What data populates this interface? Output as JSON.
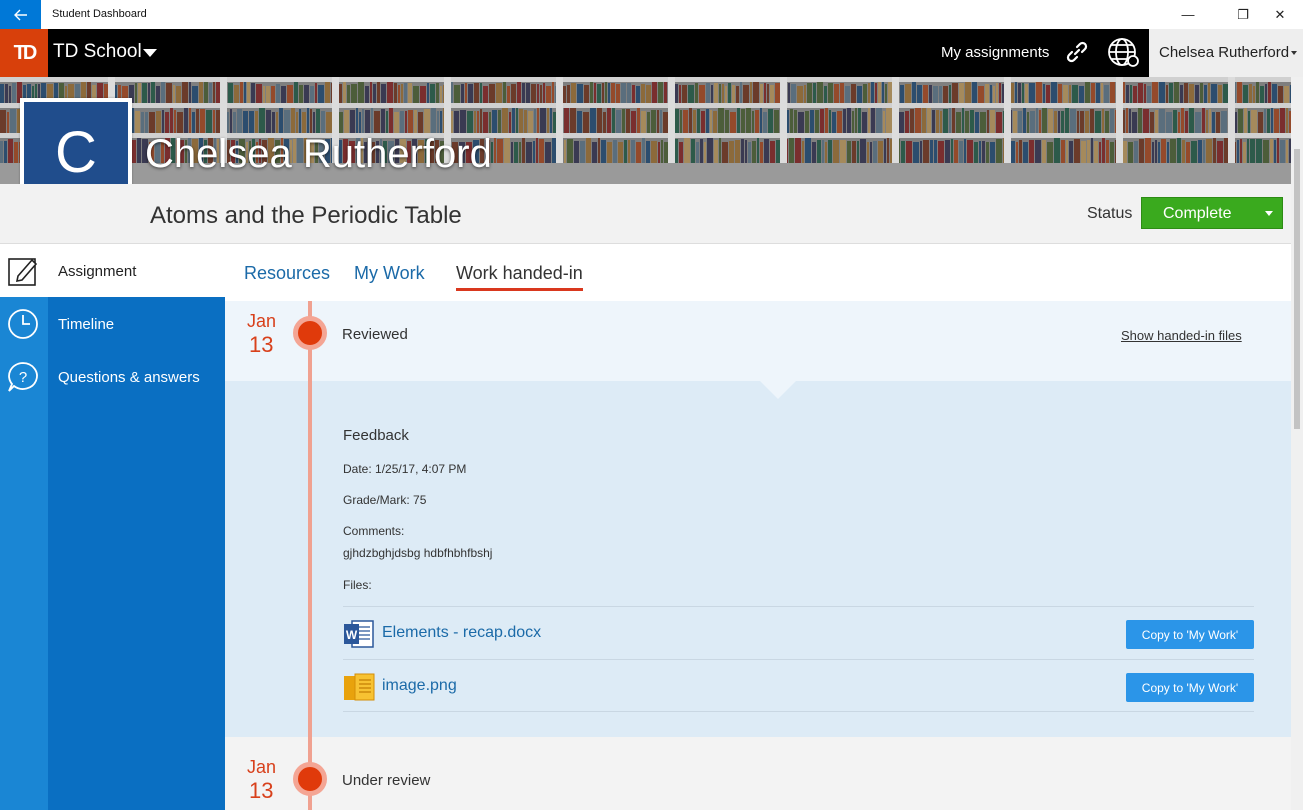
{
  "window": {
    "title": "Student Dashboard",
    "back_icon": "arrow-left-icon",
    "minimize": "—",
    "restore": "❐",
    "close": "✕"
  },
  "topnav": {
    "logo_text": "TD",
    "school": "TD School",
    "my_assignments": "My assignments",
    "user": "Chelsea Rutherford"
  },
  "profile": {
    "initial": "C",
    "name": "Chelsea Rutherford"
  },
  "assignment": {
    "title": "Atoms and the Periodic Table",
    "status_label": "Status",
    "status_value": "Complete",
    "status_color": "#3aaa1e"
  },
  "sidebar": {
    "items": [
      {
        "label": "Assignment",
        "icon": "pencil-icon"
      },
      {
        "label": "Timeline",
        "icon": "clock-icon"
      },
      {
        "label": "Questions & answers",
        "icon": "question-icon"
      }
    ]
  },
  "tabs": [
    {
      "label": "Resources"
    },
    {
      "label": "My Work"
    },
    {
      "label": "Work handed-in"
    }
  ],
  "timeline": {
    "events": [
      {
        "month": "Jan",
        "day": "13",
        "label": "Reviewed",
        "action": "Show handed-in files"
      },
      {
        "month": "Jan",
        "day": "13",
        "label": "Under review"
      }
    ],
    "feedback": {
      "title": "Feedback",
      "date_label": "Date:",
      "date_value": "1/25/17, 4:07 PM",
      "grade_label": "Grade/Mark:",
      "grade_value": "75",
      "comments_label": "Comments:",
      "comments_value": "gjhdzbghjdsbg hdbfhbhfbshj",
      "files_label": "Files:",
      "files": [
        {
          "name": "Elements - recap.docx",
          "icon": "word-doc-icon",
          "button": "Copy to 'My Work'"
        },
        {
          "name": "image.png",
          "icon": "image-file-icon",
          "button": "Copy to 'My Work'"
        }
      ]
    }
  },
  "colors": {
    "accent": "#d8400b",
    "sidebar": "#0a6fc2",
    "link": "#1b6aa8",
    "timeline_dot": "#e03a0b"
  }
}
